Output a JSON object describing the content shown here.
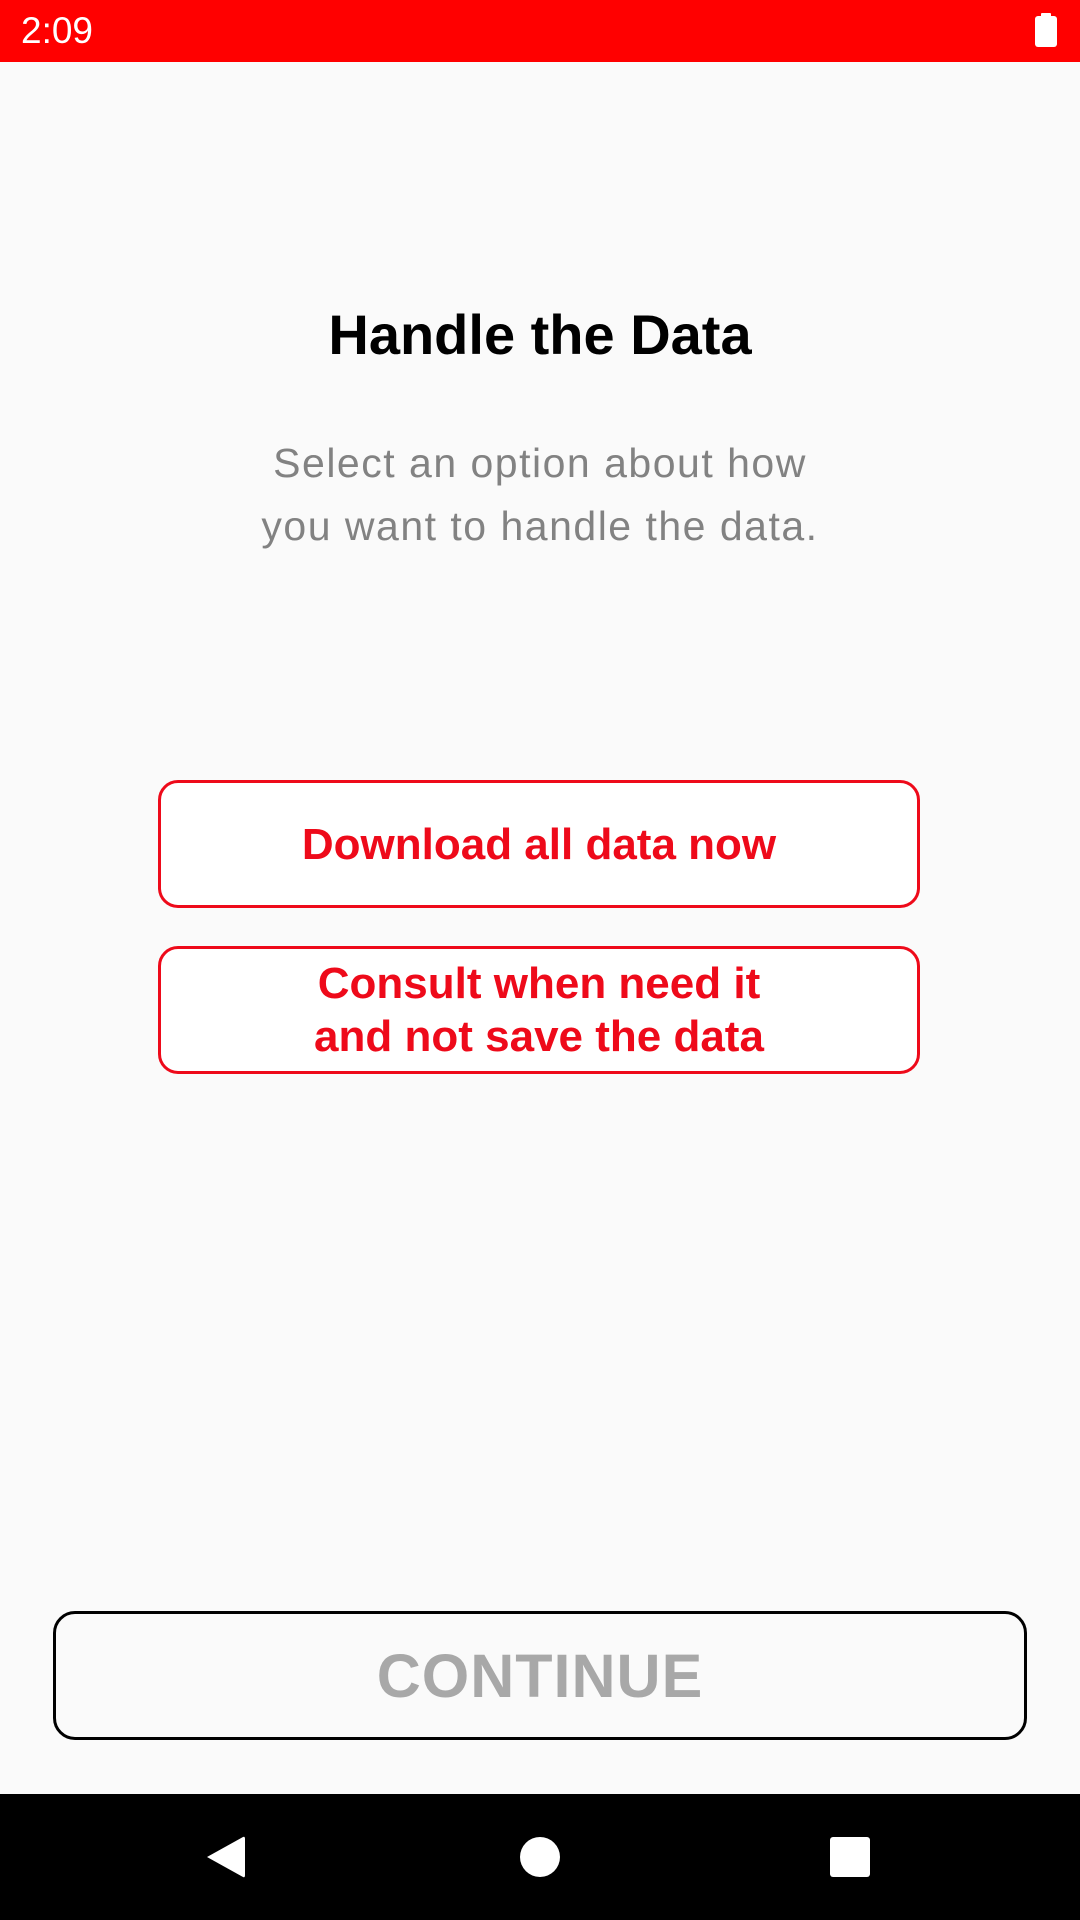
{
  "status_bar": {
    "time": "2:09",
    "battery_icon": "battery-full-icon",
    "background_color": "#ff0000"
  },
  "header": {
    "title": "Handle the Data",
    "subtitle": "Select an option about how you want to handle the data."
  },
  "options": [
    {
      "label": "Download all data now"
    },
    {
      "label": "Consult when need it\nand not save the data"
    }
  ],
  "footer": {
    "continue_label": "CONTINUE",
    "continue_enabled": false
  },
  "navigation_bar": {
    "back_icon": "back-triangle-icon",
    "home_icon": "home-circle-icon",
    "recents_icon": "recents-square-icon"
  },
  "colors": {
    "accent": "#ee0a1a",
    "disabled_text": "#a8a8a8",
    "subtitle_text": "#828282"
  }
}
